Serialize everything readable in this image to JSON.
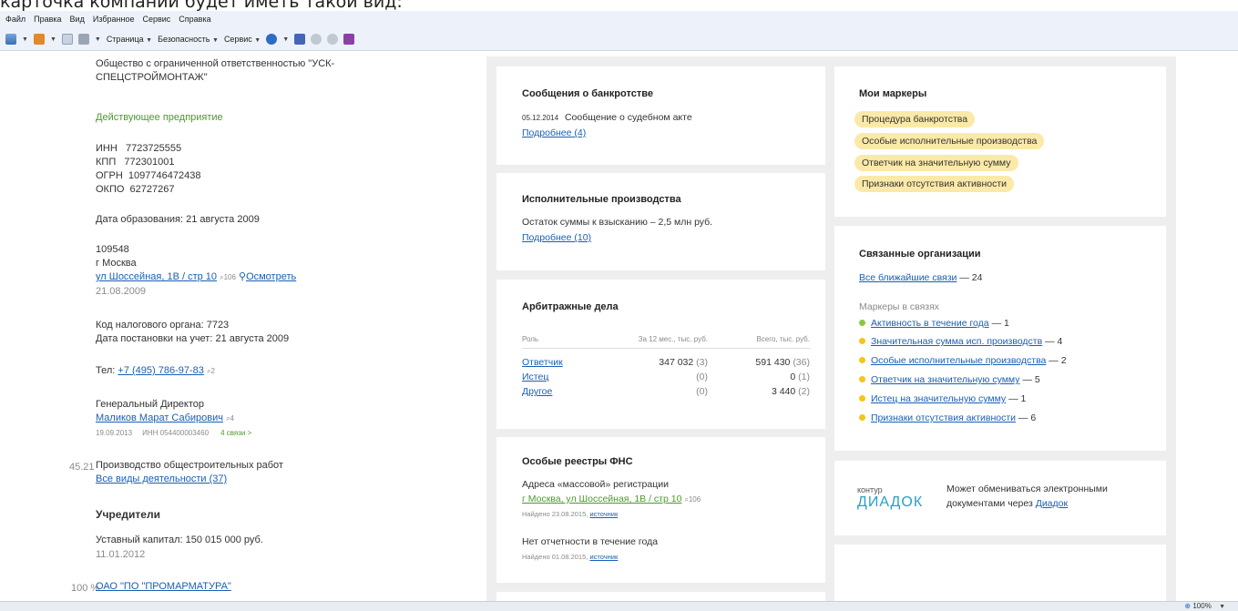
{
  "caption": "карточка компании будет иметь такой вид:",
  "ie": {
    "menu": [
      "Файл",
      "Правка",
      "Вид",
      "Избранное",
      "Сервис",
      "Справка"
    ],
    "commands": {
      "page": "Страница",
      "security": "Безопасность",
      "tools": "Сервис"
    }
  },
  "company": {
    "name_line1": "Общество с ограниченной ответственностью \"УСК-",
    "name_line2": "СПЕЦСТРОЙМОНТАЖ\"",
    "status": "Действующее предприятие",
    "inn": "ИНН   7723725555",
    "kpp": "КПП   772301001",
    "ogrn": "ОГРН  1097746472438",
    "okpo": "ОКПО  62727267",
    "founded": "Дата образования: 21 августа 2009",
    "postcode": "109548",
    "city": "г Москва",
    "street": "ул Шоссейная, 1В / стр 10",
    "street_count": "106",
    "view_link": "Осмотреть",
    "address_date": "21.08.2009",
    "tax_office": "Код налогового органа: 7723",
    "registered": "Дата постановки на учет: 21 августа 2009",
    "phone_label": "Тел:",
    "phone": "+7 (495) 786-97-83",
    "phone_count": "2",
    "director_title": "Генеральный Директор",
    "director_name": "Маликов Марат Сабирович",
    "director_count": "4",
    "director_date": "19.09.2013",
    "director_inn": "ИНН 054400003460",
    "director_links": "4 связи >",
    "okved_code": "45.21",
    "activity": "Производство общестроительных работ",
    "all_activities": "Все виды деятельности (37)",
    "founders_title": "Учредители",
    "capital": "Уставный капитал: 150 015 000 руб.",
    "capital_date": "11.01.2012",
    "founder_share": "100 %",
    "founder_name": "ОАО \"ПО \"ПРОМАРМАТУРА\""
  },
  "bankruptcy": {
    "title": "Сообщения о банкротстве",
    "date": "05.12.2014",
    "text": "Сообщение о судебном акте",
    "more": "Подробнее (4)"
  },
  "enforcement": {
    "title": "Исполнительные производства",
    "text": "Остаток суммы к взысканию – 2,5 млн руб.",
    "more": "Подробнее (10)"
  },
  "arbitration": {
    "title": "Арбитражные дела",
    "headers": [
      "Роль",
      "За 12 мес., тыс. руб.",
      "Всего, тыс. руб."
    ],
    "rows": [
      {
        "role": "Ответчик",
        "year": "347 032",
        "year_n": "(3)",
        "total": "591 430",
        "total_n": "(36)"
      },
      {
        "role": "Истец",
        "year": "",
        "year_n": "(0)",
        "total": "0",
        "total_n": "(1)"
      },
      {
        "role": "Другое",
        "year": "",
        "year_n": "(0)",
        "total": "3 440",
        "total_n": "(2)"
      }
    ]
  },
  "fns": {
    "title": "Особые реестры ФНС",
    "mass_title": "Адреса «массовой» регистрации",
    "mass_address": "г Москва, ул Шоссейная, 1В / стр 10",
    "mass_count": "106",
    "mass_found": "Найдено 23.08.2015,",
    "source": "источник",
    "no_reports": "Нет отчетности в течение года",
    "no_reports_found": "Найдено 01.08.2015,"
  },
  "markers": {
    "title": "Мои маркеры",
    "items": [
      "Процедура банкротства",
      "Особые исполнительные производства",
      "Ответчик на значительную сумму",
      "Признаки отсутствия активности"
    ]
  },
  "related": {
    "title": "Связанные организации",
    "all_link": "Все ближайшие связи",
    "all_count": "— 24",
    "subtitle": "Маркеры в связях",
    "items": [
      {
        "label": "Активность в течение года",
        "count": "— 1",
        "color": "#8cc63f"
      },
      {
        "label": "Значительная сумма исп. производств",
        "count": "— 4",
        "color": "#f5c518"
      },
      {
        "label": "Особые исполнительные производства",
        "count": "— 2",
        "color": "#f5c518"
      },
      {
        "label": "Ответчик на значительную сумму",
        "count": "— 5",
        "color": "#f5c518"
      },
      {
        "label": "Истец на значительную сумму",
        "count": "— 1",
        "color": "#f5c518"
      },
      {
        "label": "Признаки отсутствия активности",
        "count": "— 6",
        "color": "#f5c518"
      }
    ]
  },
  "diadoc": {
    "logo_top": "контур",
    "logo_bottom": "ДИАДОК",
    "text1": "Может обмениваться электронными",
    "text2": "документами через",
    "link": "Диадок"
  },
  "status_bar": {
    "zoom": "100%"
  }
}
